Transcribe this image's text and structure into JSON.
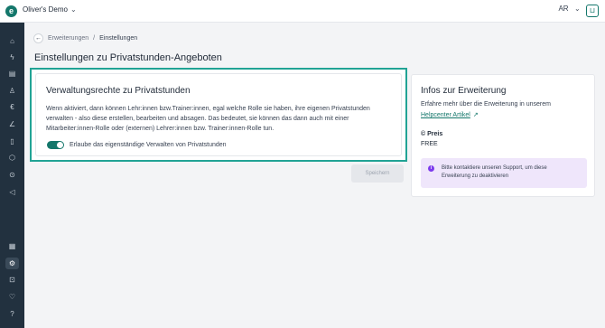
{
  "app": {
    "logo_letter": "e",
    "workspace_name": "Oliver's Demo",
    "user_initials": "AR",
    "brand_color": "#14776b"
  },
  "sidebar": {
    "items": [
      {
        "icon": "home-icon",
        "glyph": "⌂"
      },
      {
        "icon": "bolt-icon",
        "glyph": "ϟ"
      },
      {
        "icon": "calendar-icon",
        "glyph": "▤"
      },
      {
        "icon": "user-icon",
        "glyph": "♙"
      },
      {
        "icon": "euro-icon",
        "glyph": "€"
      },
      {
        "icon": "chart-icon",
        "glyph": "∠"
      },
      {
        "icon": "clipboard-icon",
        "glyph": "▯"
      },
      {
        "icon": "package-icon",
        "glyph": "⬡"
      },
      {
        "icon": "dollar-icon",
        "glyph": "⊙"
      },
      {
        "icon": "megaphone-icon",
        "glyph": "◁"
      },
      {
        "icon": "document-icon",
        "glyph": "▦"
      },
      {
        "icon": "settings-icon",
        "glyph": "⚙",
        "active": true
      },
      {
        "icon": "inbox-icon",
        "glyph": "⊡"
      },
      {
        "icon": "heart-icon",
        "glyph": "♡"
      },
      {
        "icon": "help-icon",
        "glyph": "?"
      }
    ]
  },
  "breadcrumb": {
    "back_glyph": "←",
    "parent": "Erweiterungen",
    "separator": "/",
    "current": "Einstellungen"
  },
  "page": {
    "title": "Einstellungen zu Privatstunden-Angeboten"
  },
  "settings_card": {
    "title": "Verwaltungsrechte zu Privatstunden",
    "description": "Wenn aktiviert, dann können Lehr:innen bzw.Trainer:innen, egal welche Rolle sie haben, ihre eigenen Privatstunden verwalten - also diese erstellen, bearbeiten und absagen. Das bedeutet, sie können das dann auch mit einer Mitarbeiter:innen-Rolle oder (externen) Lehrer:innen bzw. Trainer:innen-Rolle tun.",
    "toggle_label": "Erlaube das eigenständige Verwalten von Privatstunden",
    "toggle_on": true,
    "save_label": "Speichern"
  },
  "info_card": {
    "title": "Infos zur Erweiterung",
    "description": "Erfahre mehr über die Erweiterung in unserem",
    "link_label": "Helpcenter Artikel",
    "price_label": "© Preis",
    "price_value": "FREE",
    "notice_text": "Bitte kontaktiere unseren Support, um diese Erweiterung zu deaktivieren",
    "notice_color": "#efe6fb"
  }
}
